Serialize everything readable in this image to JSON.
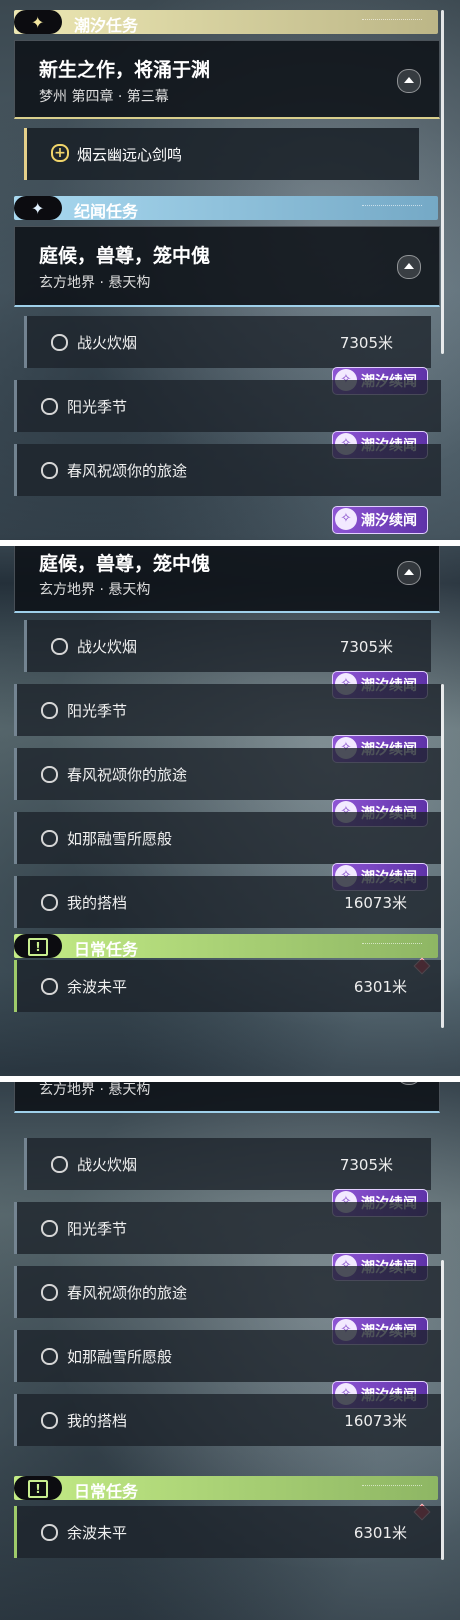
{
  "tide_section": {
    "title": "潮汐任务",
    "main_task": {
      "title": "新生之作，将涌于渊",
      "location": "梦州 第四章 · 第三幕"
    },
    "subtask": "烟云幽远心剑鸣"
  },
  "lore_section": {
    "title": "纪闻任务",
    "main_task": {
      "title": "庭候，兽尊，笼中傀",
      "location": "玄方地界 · 悬天构"
    }
  },
  "daily_section": {
    "title": "日常任务"
  },
  "tasks": [
    {
      "name": "战火炊烟",
      "distance": "7305米"
    },
    {
      "name": "阳光季节",
      "distance": ""
    },
    {
      "name": "春风祝颂你的旅途",
      "distance": ""
    },
    {
      "name": "如那融雪所愿般",
      "distance": ""
    },
    {
      "name": "我的搭档",
      "distance": "16073米"
    }
  ],
  "badge_label": "潮汐续闻",
  "daily_task": {
    "name": "余波未平",
    "distance": "6301米"
  },
  "colors": {
    "tide": "#e8e2ae",
    "lore": "#9fd0ea",
    "daily": "#b7e07f",
    "badge": "#7d45c4",
    "diamond": "#d94250"
  }
}
